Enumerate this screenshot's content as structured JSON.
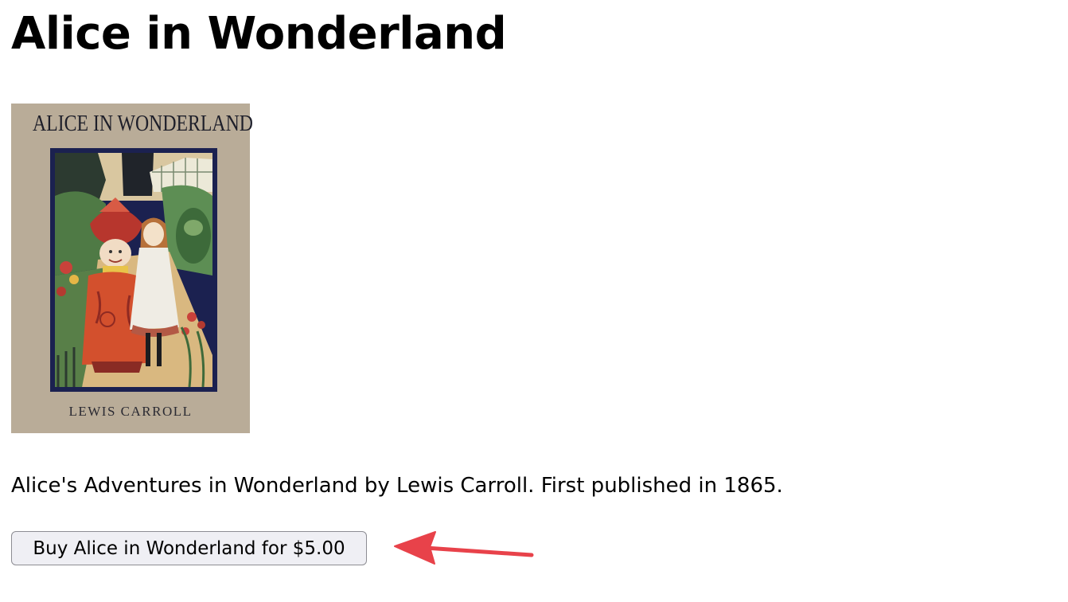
{
  "page": {
    "title": "Alice in Wonderland",
    "description": "Alice's Adventures in Wonderland by Lewis Carroll. First published in 1865."
  },
  "cover": {
    "title": "ALICE IN WONDERLAND",
    "author": "LEWIS CARROLL",
    "background_color": "#b9ac98",
    "frame_color": "#1b2150"
  },
  "buy": {
    "label": "Buy Alice in Wonderland for $5.00"
  },
  "annotation": {
    "icon": "arrow-left-icon",
    "color": "#e8424a"
  }
}
